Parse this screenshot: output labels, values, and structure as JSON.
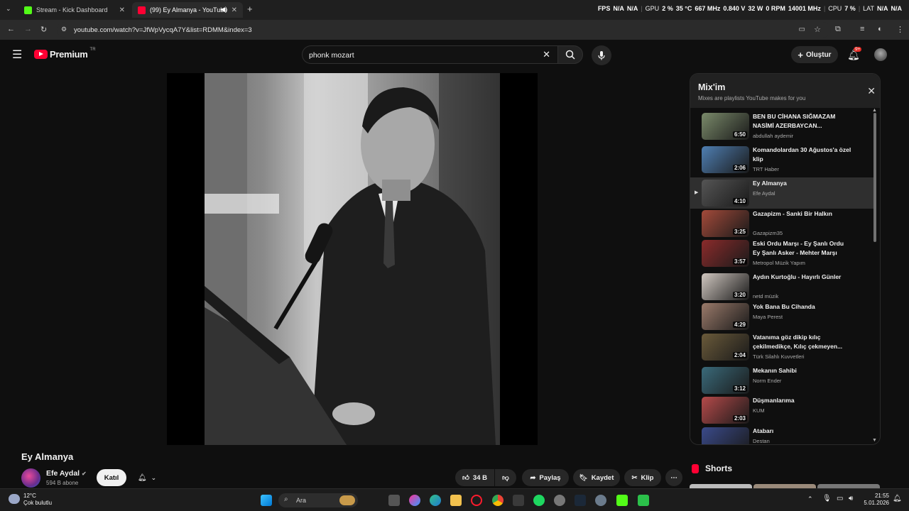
{
  "browser": {
    "tabs": [
      {
        "label": "Stream - Kick Dashboard",
        "color": "#53fc18"
      },
      {
        "label": "(99) Ey Almanya - YouTube",
        "color": "#ff0033"
      }
    ],
    "new_tab": "+",
    "url": "youtube.com/watch?v=JfWpVycqA7Y&list=RDMM&index=3"
  },
  "hud": {
    "fps_label": "FPS",
    "fps_value1": "N/A",
    "fps_value2": "N/A",
    "gpu_label": "GPU",
    "gpu_values": [
      "2 %",
      "35 °C",
      "667 MHz",
      "0.840 V",
      "32 W",
      "0 RPM",
      "14001 MHz"
    ],
    "cpu_label": "CPU",
    "cpu_value": "7 %",
    "lat_label": "LAT",
    "lat_values": [
      "N/A",
      "N/A"
    ]
  },
  "youtube": {
    "logo": "Premium",
    "region": "TR",
    "search_query": "phonk mozart",
    "create_label": "Oluştur",
    "notif_count": "9+"
  },
  "video": {
    "title": "Ey Almanya",
    "channel": "Efe Aydal",
    "subscribers": "594 B abone",
    "join_label": "Katıl",
    "likes": "34 B",
    "share_label": "Paylaş",
    "save_label": "Kaydet",
    "clip_label": "Klip"
  },
  "mix": {
    "title": "Mix'im",
    "subtitle": "Mixes are playlists YouTube makes for you",
    "items": [
      {
        "title": "BEN BU CİHANA SIĞMAZAM NASİMİ AZERBAYCAN...",
        "channel": "abdullah aydemir",
        "duration": "6:50",
        "thumb": "#7a8a6a"
      },
      {
        "title": "Komandolardan 30 Ağustos'a özel klip",
        "channel": "TRT Haber",
        "duration": "2:06",
        "thumb": "#4f7fb3"
      },
      {
        "title": "Ey Almanya",
        "channel": "Efe Aydal",
        "duration": "4:10",
        "thumb": "#555555"
      },
      {
        "title": "Gazapizm - Sanki Bir Halkın",
        "channel": "Gazapizm35",
        "duration": "3:25",
        "thumb": "#a34a3a"
      },
      {
        "title": "Eski Ordu Marşı - Ey Şanlı Ordu Ey Şanlı Asker - Mehter Marşı",
        "channel": "Metropol Müzik Yapım",
        "duration": "3:57",
        "thumb": "#8b2b2b"
      },
      {
        "title": "Aydın Kurtoğlu - Hayırlı Günler",
        "channel": "netd müzik",
        "duration": "3:20",
        "thumb": "#d0c7c0"
      },
      {
        "title": "Yok Bana Bu Cihanda",
        "channel": "Maya Perest",
        "duration": "4:29",
        "thumb": "#9a7a6a"
      },
      {
        "title": "Vatanıma göz dikip kılıç çekilmedikçe, Kılıç çekmeyen...",
        "channel": "Türk Silahlı Kuvvetleri",
        "duration": "2:04",
        "thumb": "#6a5a3a"
      },
      {
        "title": "Mekanın Sahibi",
        "channel": "Norm Ender",
        "duration": "3:12",
        "thumb": "#3a6a7a"
      },
      {
        "title": "Düşmanlarıma",
        "channel": "KUM",
        "duration": "2:03",
        "thumb": "#b54a4a"
      },
      {
        "title": "Atabarı",
        "channel": "Destan",
        "duration": "",
        "thumb": "#3a4a8a"
      }
    ]
  },
  "shorts": {
    "label": "Shorts"
  },
  "taskbar": {
    "temp": "12°C",
    "weather": "Çok bulutlu",
    "search": "Ara",
    "time": "21:55",
    "date": "5.01.2026"
  }
}
